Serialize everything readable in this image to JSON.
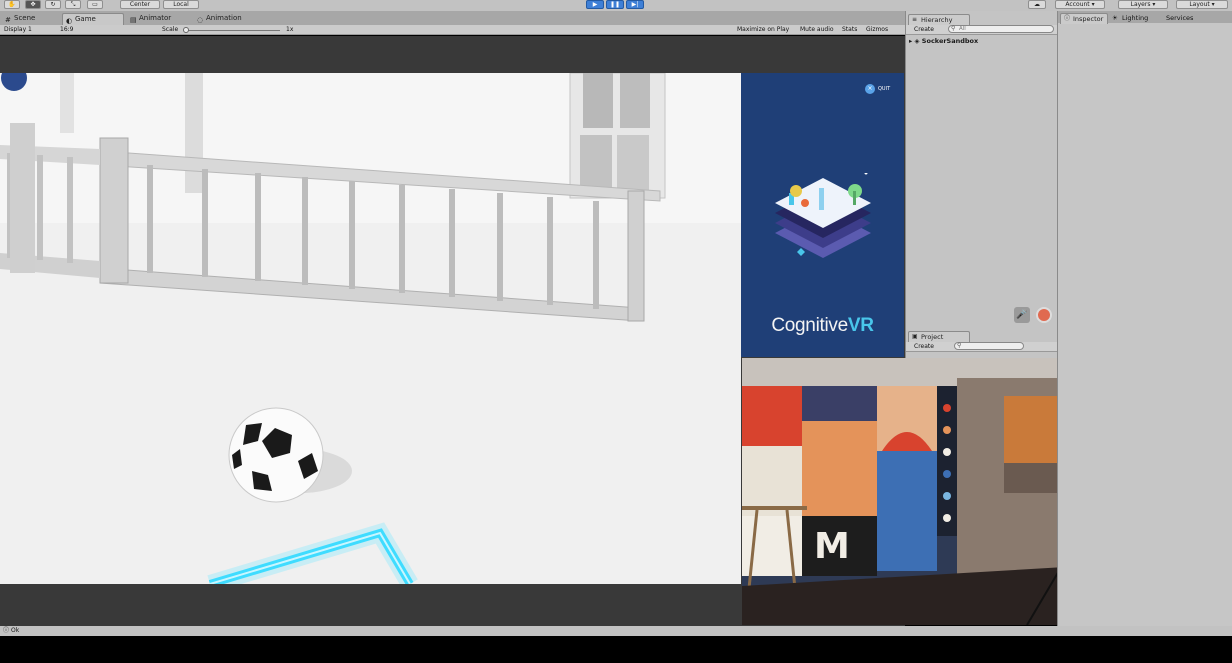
{
  "toolbar": {
    "pivot_label": "Center",
    "space_label": "Local",
    "account_label": "Account",
    "layers_label": "Layers",
    "layout_label": "Layout"
  },
  "tabs": [
    {
      "label": "Scene",
      "icon": "scene-icon"
    },
    {
      "label": "Game",
      "icon": "game-icon"
    },
    {
      "label": "Animator",
      "icon": "animator-icon"
    },
    {
      "label": "Animation",
      "icon": "animation-icon"
    }
  ],
  "game_bar": {
    "display": "Display 1",
    "aspect": "16:9",
    "scale_label": "Scale",
    "scale_value": "1x",
    "maximize": "Maximize on Play",
    "mute": "Mute audio",
    "stats": "Stats",
    "gizmos": "Gizmos"
  },
  "promo": {
    "quit_label": "QUIT",
    "brand_plain": "Cognitive",
    "brand_bold": "VR"
  },
  "hierarchy": {
    "tab_label": "Hierarchy",
    "create_label": "Create",
    "search_placeholder": "All",
    "scene_name": "SockerSandbox"
  },
  "project": {
    "tab_label": "Project",
    "create_label": "Create"
  },
  "inspector_tabs": {
    "inspector": "Inspector",
    "lighting": "Lighting",
    "services": "Services"
  },
  "status": {
    "text": "Ok"
  },
  "colors": {
    "brand_accent": "#49c6ea",
    "promo_bg": "#1f3f77",
    "play_blue": "#3e7fd6"
  }
}
